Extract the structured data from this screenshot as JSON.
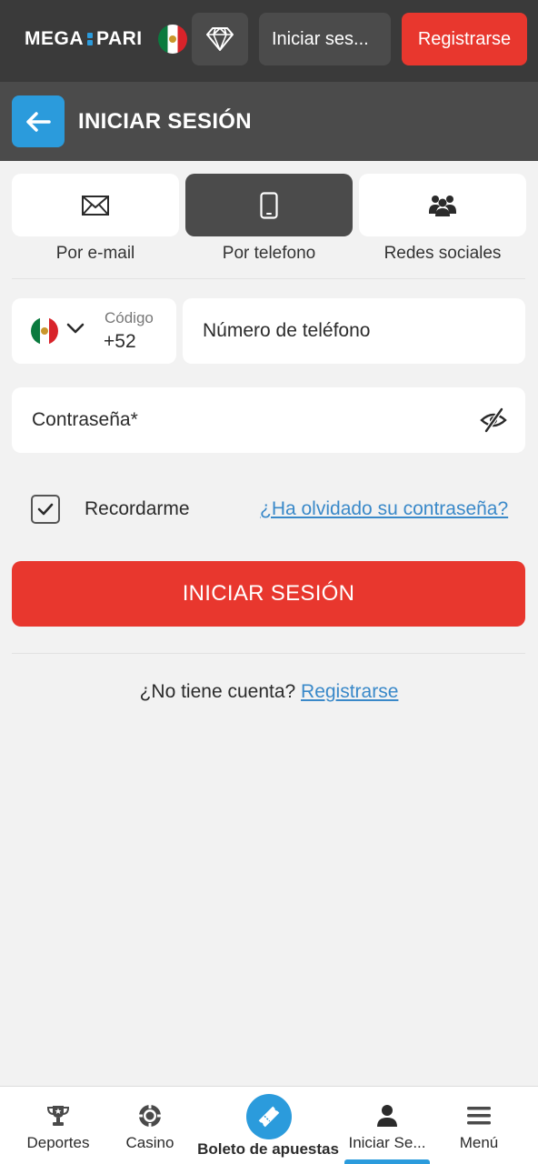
{
  "header": {
    "logo_left": "MEGA",
    "logo_right": "PARI",
    "login_label": "Iniciar ses...",
    "register_label": "Registrarse"
  },
  "subheader": {
    "title": "INICIAR SESIÓN"
  },
  "methods": [
    {
      "label": "Por e-mail",
      "icon": "envelope-icon",
      "active": false
    },
    {
      "label": "Por telefono",
      "icon": "phone-icon",
      "active": true
    },
    {
      "label": "Redes sociales",
      "icon": "users-icon",
      "active": false
    }
  ],
  "phone": {
    "code_label": "Código",
    "code_value": "+52",
    "placeholder": "Número de teléfono",
    "value": ""
  },
  "password": {
    "placeholder": "Contraseña*",
    "value": ""
  },
  "remember": {
    "label": "Recordarme",
    "checked": true
  },
  "forgot_label": "¿Ha olvidado su contraseña?",
  "submit_label": "INICIAR SESIÓN",
  "no_account": {
    "text": "¿No tiene cuenta?",
    "link": "Registrarse"
  },
  "bottom_nav": [
    {
      "label": "Deportes",
      "icon": "trophy-icon"
    },
    {
      "label": "Casino",
      "icon": "casino-chip-icon"
    },
    {
      "label": "Boleto de apuestas",
      "icon": "ticket-icon"
    },
    {
      "label": "Iniciar Se...",
      "icon": "user-icon",
      "active": true
    },
    {
      "label": "Menú",
      "icon": "hamburger-icon"
    }
  ],
  "colors": {
    "accent_red": "#e8372e",
    "accent_blue": "#2b9bdc",
    "header_dark": "#3a3a3a",
    "link_blue": "#3a89c9"
  }
}
